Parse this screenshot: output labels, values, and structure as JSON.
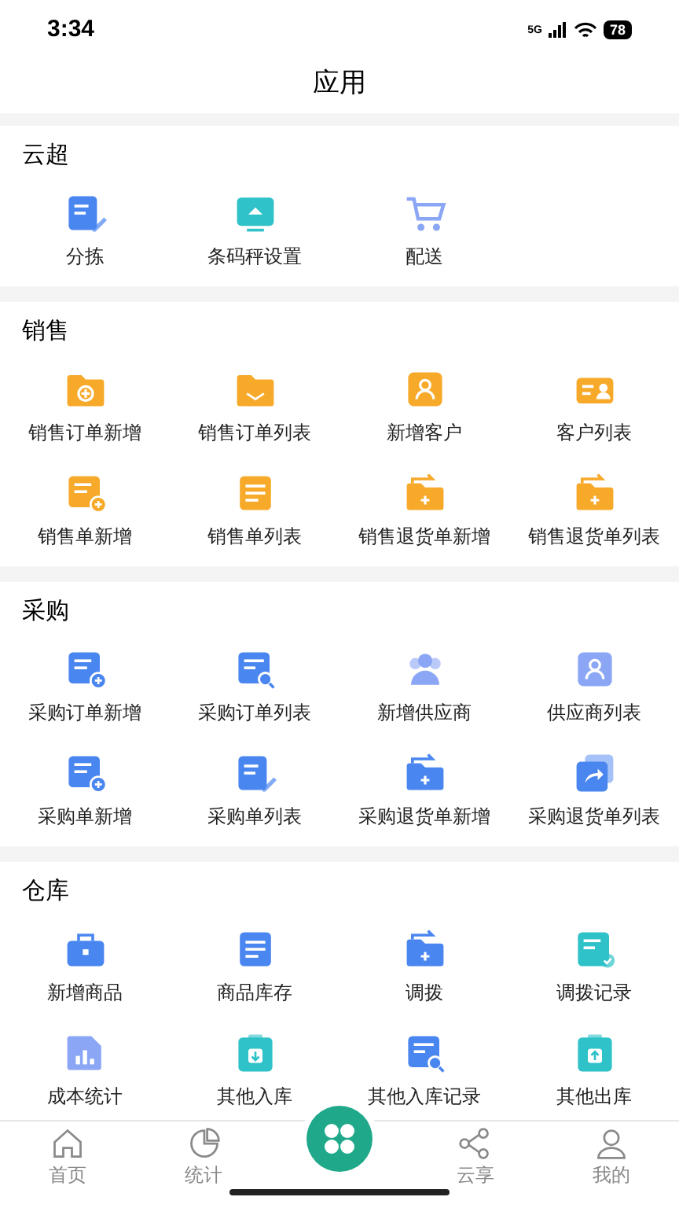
{
  "status_bar": {
    "time": "3:34",
    "network": "5G",
    "battery": "78"
  },
  "header": {
    "title": "应用"
  },
  "sections": [
    {
      "title": "云超",
      "items": [
        {
          "label": "分拣"
        },
        {
          "label": "条码秤设置"
        },
        {
          "label": "配送"
        }
      ]
    },
    {
      "title": "销售",
      "items": [
        {
          "label": "销售订单新增"
        },
        {
          "label": "销售订单列表"
        },
        {
          "label": "新增客户"
        },
        {
          "label": "客户列表"
        },
        {
          "label": "销售单新增"
        },
        {
          "label": "销售单列表"
        },
        {
          "label": "销售退货单新增"
        },
        {
          "label": "销售退货单列表"
        }
      ]
    },
    {
      "title": "采购",
      "items": [
        {
          "label": "采购订单新增"
        },
        {
          "label": "采购订单列表"
        },
        {
          "label": "新增供应商"
        },
        {
          "label": "供应商列表"
        },
        {
          "label": "采购单新增"
        },
        {
          "label": "采购单列表"
        },
        {
          "label": "采购退货单新增"
        },
        {
          "label": "采购退货单列表"
        }
      ]
    },
    {
      "title": "仓库",
      "items": [
        {
          "label": "新增商品"
        },
        {
          "label": "商品库存"
        },
        {
          "label": "调拨"
        },
        {
          "label": "调拨记录"
        },
        {
          "label": "成本统计"
        },
        {
          "label": "其他入库"
        },
        {
          "label": "其他入库记录"
        },
        {
          "label": "其他出库"
        }
      ]
    }
  ],
  "bottom_nav": [
    {
      "kind": "tab",
      "label": "首页",
      "selected": false
    },
    {
      "kind": "tab",
      "label": "统计",
      "selected": false
    },
    {
      "kind": "center"
    },
    {
      "kind": "tab",
      "label": "云享",
      "selected": false
    },
    {
      "kind": "tab",
      "label": "我的",
      "selected": false
    }
  ]
}
